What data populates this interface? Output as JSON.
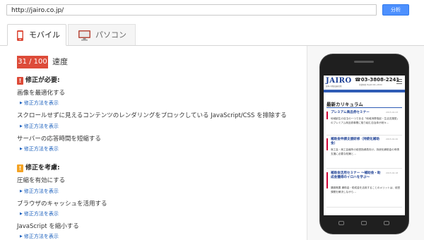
{
  "url_bar": {
    "value": "http://jairo.co.jp/",
    "analyze_label": "分析"
  },
  "tabs": [
    {
      "label": "モバイル",
      "icon": "mobile-phone-icon",
      "active": true
    },
    {
      "label": "パソコン",
      "icon": "desktop-monitor-icon",
      "active": false
    }
  ],
  "score": {
    "value": "31 / 100",
    "label": "速度",
    "color": "#dd4b39"
  },
  "sections": {
    "must_fix": {
      "title": "修正が必要:",
      "mark": "!",
      "color": "#dd4b39",
      "items": [
        {
          "title": "画像を最適化する",
          "link": "修正方法を表示"
        },
        {
          "title": "スクロールせずに見えるコンテンツのレンダリングをブロックしている JavaScript/CSS を排除する",
          "link": "修正方法を表示"
        },
        {
          "title": "サーバーの応答時間を短縮する",
          "link": "修正方法を表示"
        }
      ]
    },
    "consider_fixing": {
      "title": "修正を考慮:",
      "mark": "!",
      "color": "#f4a324",
      "items": [
        {
          "title": "圧縮を有効にする",
          "link": "修正方法を表示"
        },
        {
          "title": "ブラウザのキャッシュを活用する",
          "link": "修正方法を表示"
        },
        {
          "title": "JavaScript を縮小する",
          "link": "修正方法を表示"
        }
      ]
    }
  },
  "preview": {
    "logo": "JAIRO",
    "logo_sub": "日本人材育成研究所",
    "phone": "☎03-3808-2241",
    "hours": "営業時間 平日10:00〜18:00",
    "curriculum_title": "最新カリキュラム",
    "cards": [
      {
        "title": "プレミアム商品券セミナー",
        "date": "2015.02.23",
        "body": "地域創生の目玉の一つである「地域消費喚起・生活支援型」のプレミアム商品券事業に取り組む自治体が続々…"
      },
      {
        "title": "補助金申請支援研修（持続化補助金）",
        "date": "2015.02.20",
        "body": "商工会・商工会議所の経営指導員向け。持続化補助金の申請支援に必要な知識と…"
      },
      {
        "title": "補助金活用セミナー 〜補助金・助成金獲得のイロハを学ぶ〜",
        "date": "2015.02.18",
        "body": "講座概要 補助金・助成金を活用することのメリットは、経営課題を解決しながら…"
      }
    ]
  }
}
